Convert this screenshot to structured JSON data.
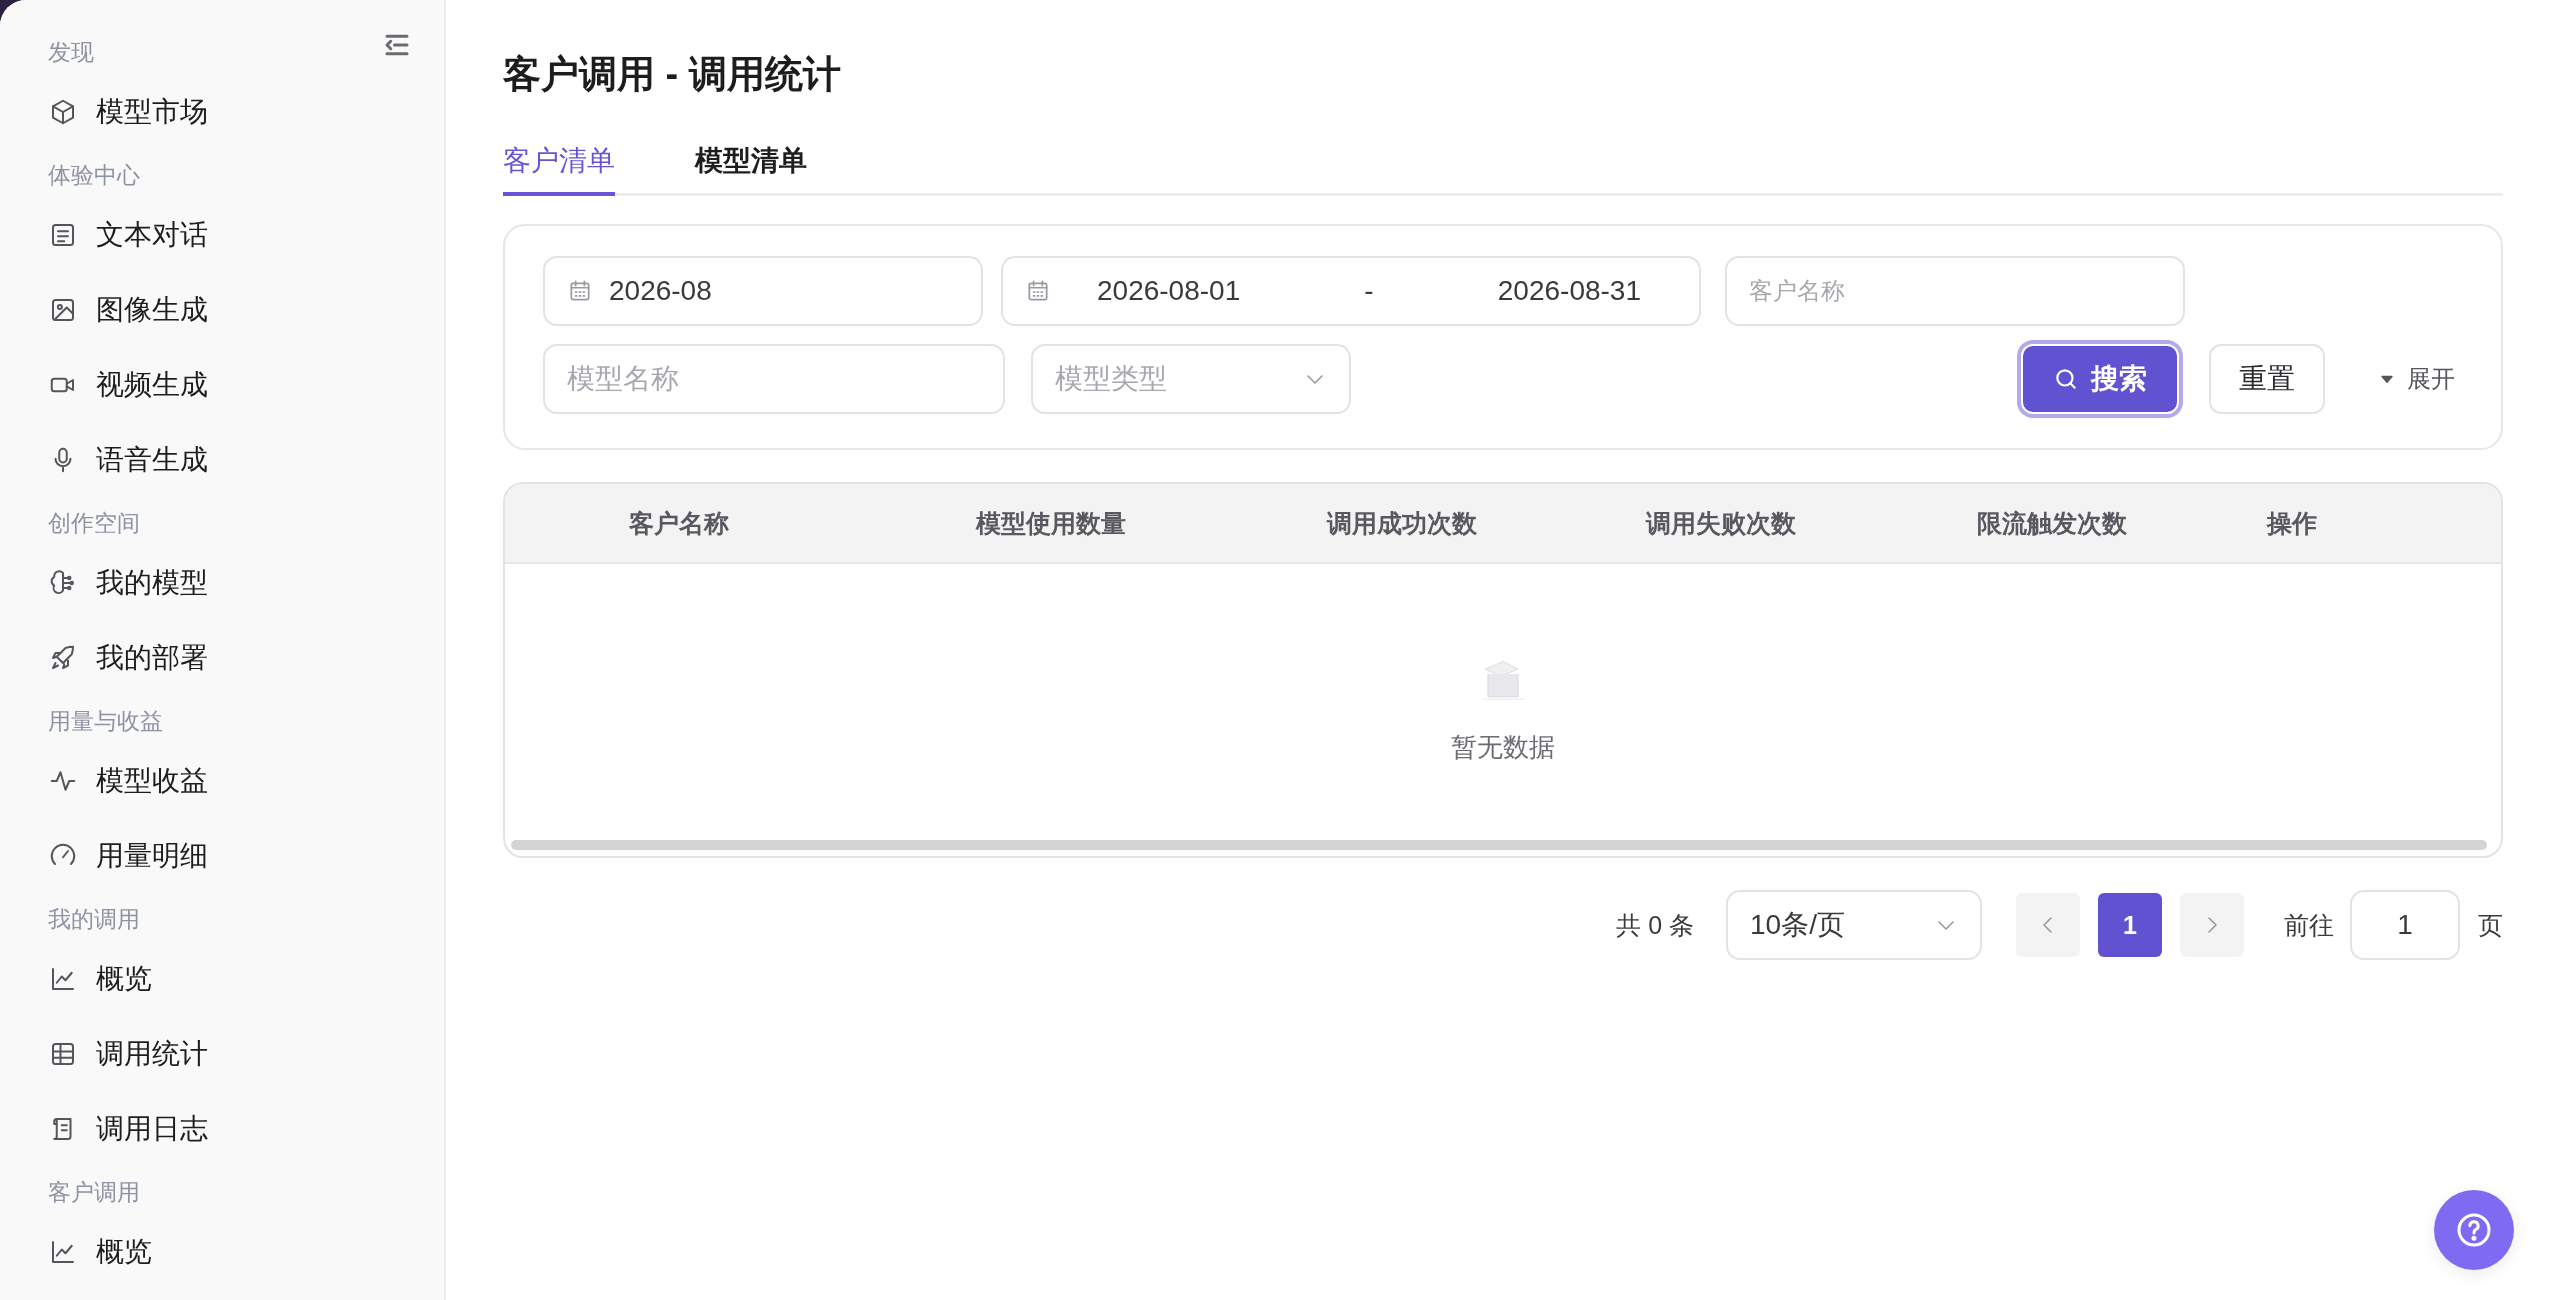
{
  "sidebar": {
    "groups": [
      {
        "label": "发现",
        "items": [
          {
            "label": "模型市场"
          }
        ]
      },
      {
        "label": "体验中心",
        "items": [
          {
            "label": "文本对话"
          },
          {
            "label": "图像生成"
          },
          {
            "label": "视频生成"
          },
          {
            "label": "语音生成"
          }
        ]
      },
      {
        "label": "创作空间",
        "items": [
          {
            "label": "我的模型"
          },
          {
            "label": "我的部署"
          }
        ]
      },
      {
        "label": "用量与收益",
        "items": [
          {
            "label": "模型收益"
          },
          {
            "label": "用量明细"
          }
        ]
      },
      {
        "label": "我的调用",
        "items": [
          {
            "label": "概览"
          },
          {
            "label": "调用统计"
          },
          {
            "label": "调用日志"
          }
        ]
      },
      {
        "label": "客户调用",
        "items": [
          {
            "label": "概览"
          }
        ]
      }
    ]
  },
  "page_title": "客户调用 - 调用统计",
  "tabs": [
    {
      "label": "客户清单",
      "selected": true
    },
    {
      "label": "模型清单",
      "selected": false
    }
  ],
  "filters": {
    "month": {
      "value": "2026-08"
    },
    "date_range": {
      "start": "2026-08-01",
      "separator": "-",
      "end": "2026-08-31"
    },
    "customer_name": {
      "placeholder": "客户名称"
    },
    "model_name": {
      "placeholder": "模型名称"
    },
    "model_type": {
      "placeholder": "模型类型"
    },
    "search_button": "搜索",
    "reset_button": "重置",
    "expand_toggle": "展开"
  },
  "table": {
    "columns": [
      "客户名称",
      "模型使用数量",
      "调用成功次数",
      "调用失败次数",
      "限流触发次数",
      "操作"
    ],
    "empty_text": "暂无数据"
  },
  "pagination": {
    "total": "共 0 条",
    "page_size": "10条/页",
    "pages": [
      {
        "label": "1",
        "selected": true
      }
    ],
    "goto_label": "前往",
    "goto_value": "1",
    "goto_suffix": "页"
  }
}
